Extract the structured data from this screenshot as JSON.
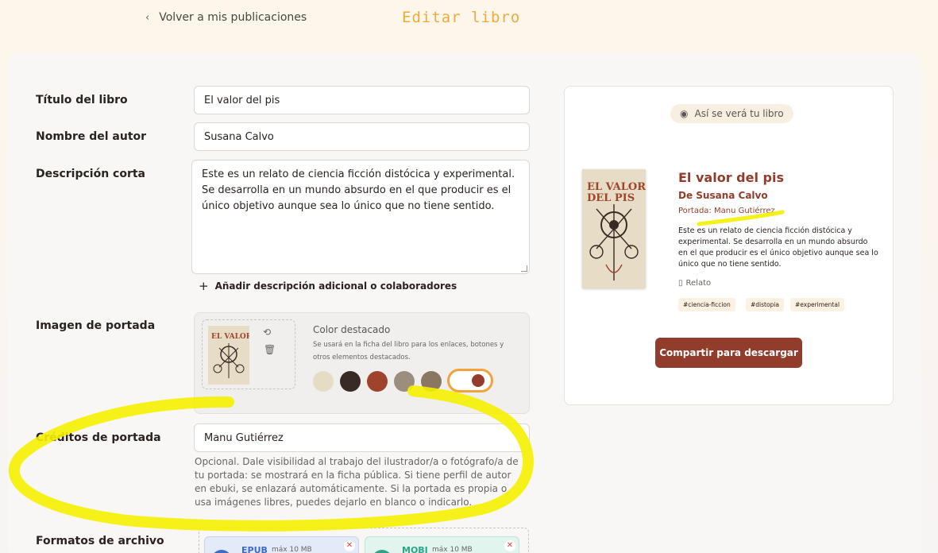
{
  "header": {
    "back_label": "Volver a mis publicaciones",
    "title": "Editar libro"
  },
  "form": {
    "title_label": "Título del libro",
    "title_value": "El valor del pis",
    "author_label": "Nombre del autor",
    "author_value": "Susana Calvo",
    "desc_label": "Descripción corta",
    "desc_value": "Este es un relato de ciencia ficción distócica y experimental. Se desarrolla en un mundo absurdo en el que producir es el único objetivo aunque sea lo único que no tiene sentido.",
    "add_desc_label": "Añadir descripción adicional o colaboradores",
    "cover_label": "Imagen de portada",
    "color_title": "Color destacado",
    "color_sub": "Se usará en la ficha del libro para los enlaces, botones y otros elementos destacados.",
    "swatches": [
      "#e5dcc6",
      "#3a2a25",
      "#a0432d",
      "#9c8e7e",
      "#8a7761"
    ],
    "selected_swatch": "#923d2b",
    "credits_label": "Créditos de portada",
    "credits_value": "Manu Gutiérrez",
    "credits_help": "Opcional. Dale visibilidad al trabajo del ilustrador/a o fotógrafo/a de tu portada: se mostrará en la ficha pública. Si tiene perfil de autor en ebuki, se enlazará automáticamente. Si la portada es propia o usa imágenes libres, puedes dejarlo en blanco o indicarlo.",
    "formats_label": "Formatos de archivo",
    "files": [
      {
        "name": "EPUB",
        "max": "máx 10 MB",
        "color": "#3b6cc9"
      },
      {
        "name": "MOBI",
        "max": "máx 10 MB",
        "color": "#2aa58a"
      }
    ]
  },
  "preview": {
    "pill": "Así se verá tu libro",
    "title": "El valor del pis",
    "author": "De Susana Calvo",
    "credit": "Portada: Manu Gutiérrez",
    "desc": "Este es un relato de ciencia ficción distócica y experimental. Se desarrolla en un mundo absurdo en el que producir es el único objetivo aunque sea lo único que no tiene sentido.",
    "type": "Relato",
    "tags": [
      "#ciencia-ficcion",
      "#distopia",
      "#experimental"
    ],
    "share": "Compartir para descargar"
  },
  "colors": {
    "accent": "#923d2b",
    "title_accent": "#f2a93c",
    "highlight": "#f5ef00"
  }
}
